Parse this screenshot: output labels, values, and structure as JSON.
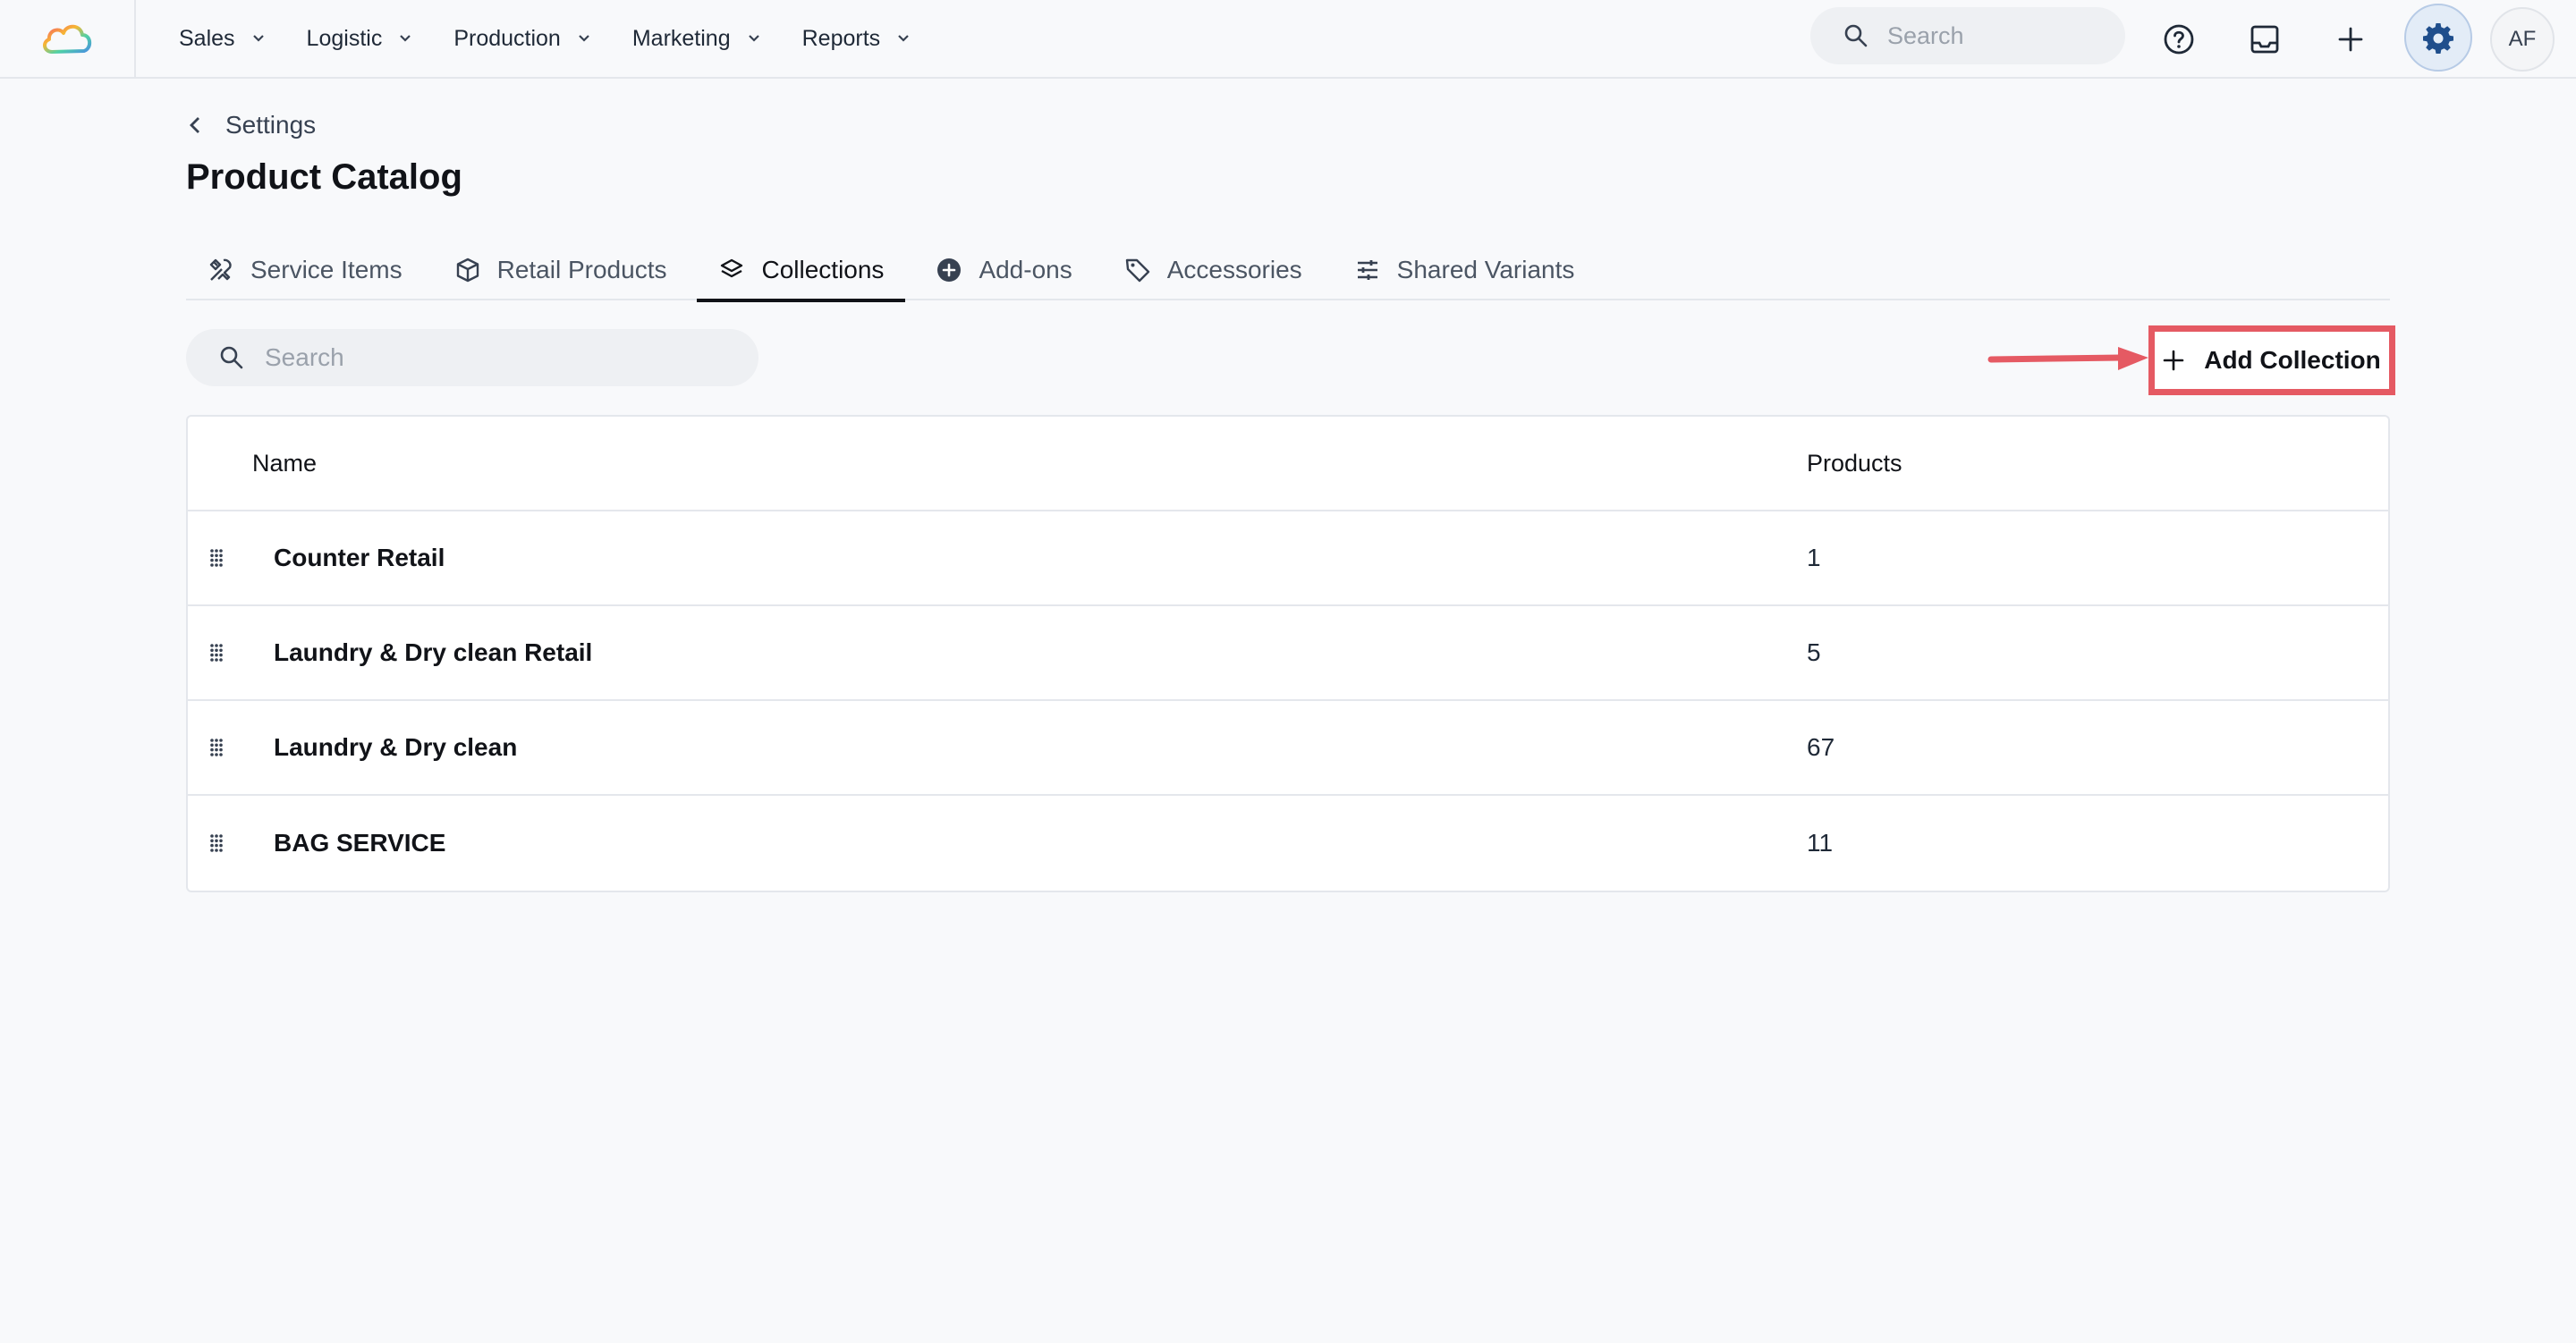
{
  "nav": {
    "items": [
      {
        "label": "Sales"
      },
      {
        "label": "Logistic"
      },
      {
        "label": "Production"
      },
      {
        "label": "Marketing"
      },
      {
        "label": "Reports"
      }
    ],
    "search_placeholder": "Search",
    "avatar_initials": "AF"
  },
  "breadcrumb": {
    "label": "Settings"
  },
  "page": {
    "title": "Product Catalog"
  },
  "tabs": [
    {
      "label": "Service Items",
      "icon": "tools-icon"
    },
    {
      "label": "Retail Products",
      "icon": "box-icon"
    },
    {
      "label": "Collections",
      "icon": "layers-icon",
      "active": true
    },
    {
      "label": "Add-ons",
      "icon": "plus-circle-icon"
    },
    {
      "label": "Accessories",
      "icon": "tag-icon"
    },
    {
      "label": "Shared Variants",
      "icon": "sliders-icon"
    }
  ],
  "list": {
    "search_placeholder": "Search",
    "add_button_label": "Add Collection",
    "columns": {
      "name": "Name",
      "products": "Products"
    },
    "rows": [
      {
        "name": "Counter Retail",
        "products": "1"
      },
      {
        "name": "Laundry & Dry clean Retail",
        "products": "5"
      },
      {
        "name": "Laundry & Dry clean",
        "products": "67"
      },
      {
        "name": "BAG SERVICE",
        "products": "11"
      }
    ]
  },
  "colors": {
    "highlight": "#e55a63",
    "accent": "#1f4e8c"
  }
}
